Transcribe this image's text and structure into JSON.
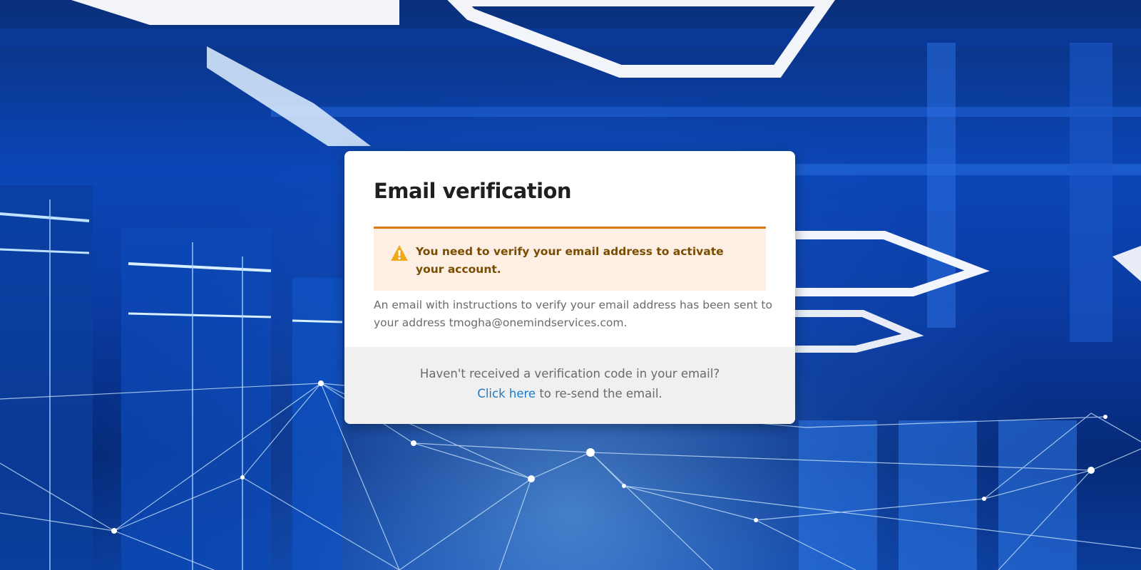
{
  "card": {
    "title": "Email verification",
    "alert": {
      "icon": "warning-icon",
      "message": "You need to verify your email address to activate your account.",
      "color": "#e07a10"
    },
    "info_text": "An email with instructions to verify your email address has been sent to your address tmogha@onemindservices.com.",
    "footer": {
      "question": "Haven't received a verification code in your email?",
      "link_label": "Click here",
      "link_suffix": " to re-send the email."
    }
  },
  "colors": {
    "accent_link": "#1a7ac8",
    "alert_border": "#e07a10",
    "alert_bg": "#fdefe3",
    "background": "#0b46b8"
  }
}
